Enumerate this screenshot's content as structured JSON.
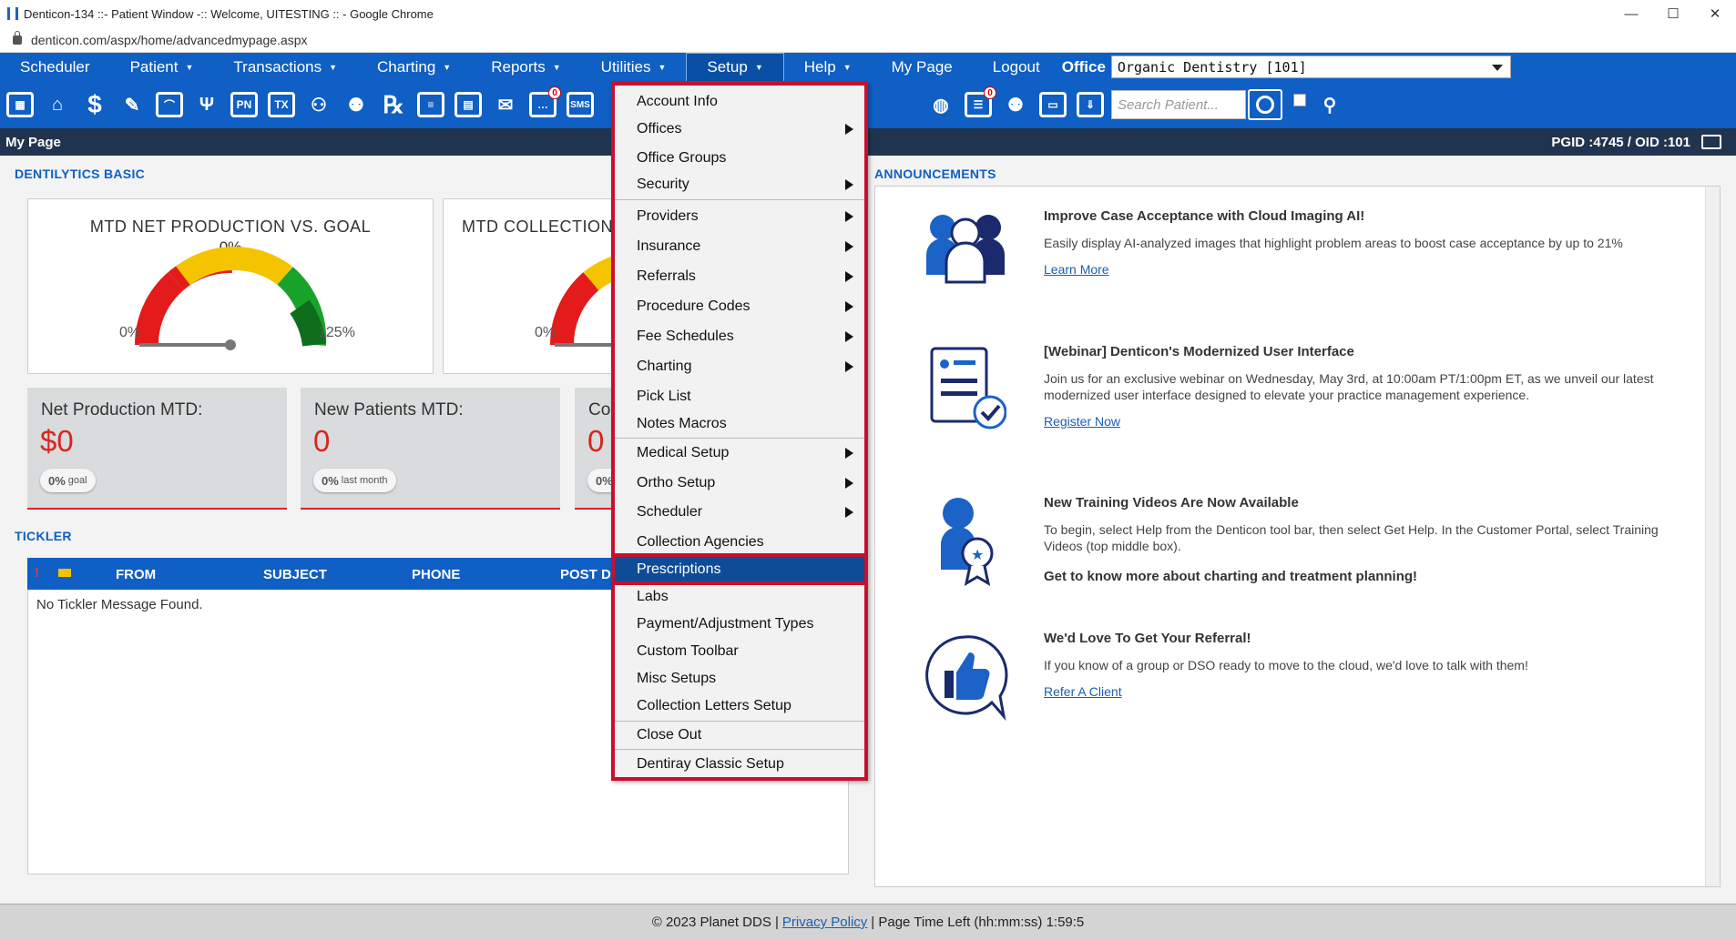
{
  "window": {
    "title": "Denticon-134 ::- Patient Window -:: Welcome, UITESTING :: - Google Chrome",
    "minimize": "—",
    "maximize": "☐",
    "close": "✕"
  },
  "address": {
    "url": "denticon.com/aspx/home/advancedmypage.aspx"
  },
  "nav": {
    "items": [
      "Scheduler",
      "Patient",
      "Transactions",
      "Charting",
      "Reports",
      "Utilities",
      "Setup",
      "Help",
      "My Page",
      "Logout"
    ],
    "office_label": "Office",
    "office_value": "Organic Dentistry [101]"
  },
  "toolbar": {
    "search_placeholder": "Search Patient...",
    "sms_label": "SMS",
    "badge_count": "0"
  },
  "page_header": {
    "title": "My Page",
    "ids": "PGID :4745  /  OID :101"
  },
  "dentilytics": {
    "section_title": "DENTILYTICS BASIC",
    "gauge1": {
      "title": "MTD NET PRODUCTION VS. GOAL",
      "pct": "0%",
      "min": "0%",
      "max": "125%"
    },
    "gauge2": {
      "title": "MTD COLLECTION",
      "min": "0%"
    },
    "stats": [
      {
        "label": "Net Production MTD:",
        "value": "$0",
        "pill_pct": "0%",
        "pill_text": "goal"
      },
      {
        "label": "New Patients MTD:",
        "value": "0",
        "pill_pct": "0%",
        "pill_text": "last month"
      },
      {
        "label": "Co",
        "value": "0",
        "pill_pct": "0%",
        "pill_text": ""
      }
    ]
  },
  "tickler": {
    "section_title": "TICKLER",
    "columns": [
      "FROM",
      "SUBJECT",
      "PHONE",
      "POST D"
    ],
    "empty": "No Tickler Message Found."
  },
  "announcements": {
    "section_title": "ANNOUNCEMENTS",
    "items": [
      {
        "title": "Improve Case Acceptance with Cloud Imaging AI!",
        "body": "Easily display AI-analyzed images that highlight problem areas to boost case acceptance by up to 21%",
        "link": "Learn More"
      },
      {
        "title": "[Webinar] Denticon's Modernized User Interface",
        "body": "Join us for an exclusive webinar on Wednesday, May 3rd, at 10:00am PT/1:00pm ET, as we unveil our latest modernized user interface designed to elevate your practice management experience.",
        "link": "Register Now"
      },
      {
        "title": "New Training Videos Are Now Available",
        "body": "To begin, select Help from the Denticon tool bar, then select Get Help. In the Customer Portal, select Training Videos (top middle box).",
        "bold": "Get to know more about charting and treatment planning!"
      },
      {
        "title": "We'd Love To Get Your Referral!",
        "body": "If you know of a group or DSO ready to move to the cloud, we'd love to talk with them!",
        "link": "Refer A Client"
      }
    ]
  },
  "setup_menu": {
    "items": [
      "Account Info",
      "Offices",
      "Office Groups",
      "Security",
      "Providers",
      "Insurance",
      "Referrals",
      "Procedure Codes",
      "Fee Schedules",
      "Charting",
      "Pick List",
      "Notes Macros",
      "Medical Setup",
      "Ortho Setup",
      "Scheduler",
      "Collection Agencies",
      "Prescriptions",
      "Labs",
      "Payment/Adjustment Types",
      "Custom Toolbar",
      "Misc Setups",
      "Collection Letters Setup",
      "Close Out",
      "Dentiray Classic Setup"
    ]
  },
  "footer": {
    "copyright": "© 2023 Planet DDS |",
    "privacy": "Privacy Policy",
    "time_left": "| Page Time Left (hh:mm:ss) 1:59:5"
  },
  "colors": {
    "brand_blue": "#0f5fc4",
    "header_navy": "#21344f",
    "highlight_red": "#c8102e",
    "value_red": "#d7261e"
  }
}
